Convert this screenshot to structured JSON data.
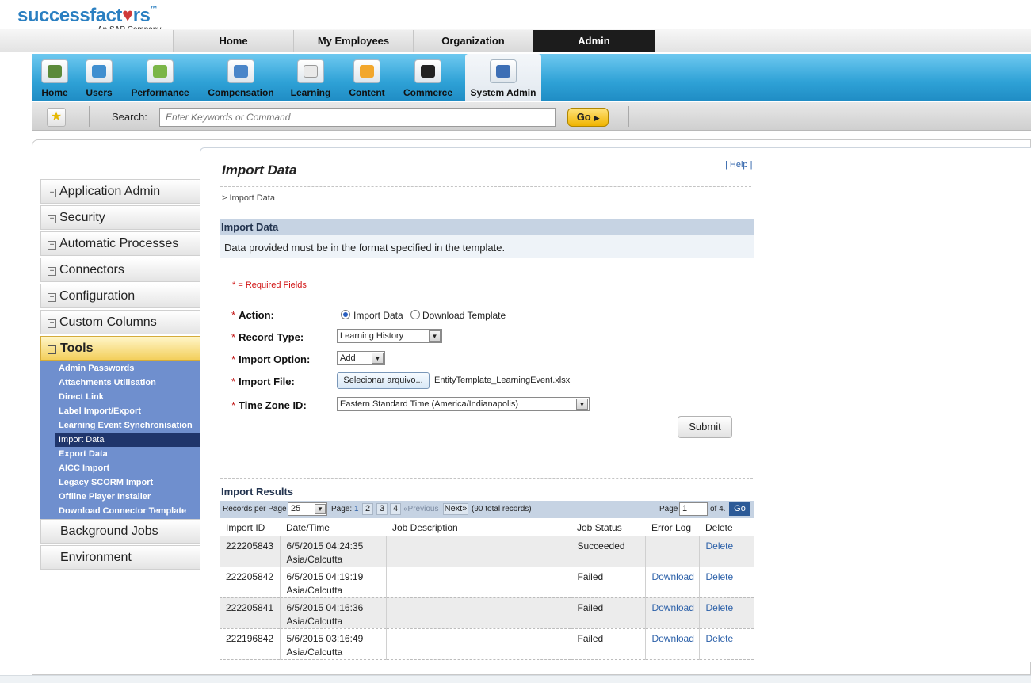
{
  "brand": {
    "logo_text_1": "successfact",
    "logo_heart": "♥",
    "logo_text_2": "rs",
    "tm": "™",
    "subtitle": "An SAP Company"
  },
  "top_tabs": [
    "Home",
    "My Employees",
    "Organization",
    "Admin"
  ],
  "modules": [
    {
      "label": "Home",
      "icon": "home-icon"
    },
    {
      "label": "Users",
      "icon": "users-icon"
    },
    {
      "label": "Performance",
      "icon": "performance-icon"
    },
    {
      "label": "Compensation",
      "icon": "compensation-icon"
    },
    {
      "label": "Learning",
      "icon": "learning-icon"
    },
    {
      "label": "Content",
      "icon": "content-icon"
    },
    {
      "label": "Commerce",
      "icon": "commerce-icon"
    },
    {
      "label": "System Admin",
      "icon": "system-admin-icon"
    }
  ],
  "search": {
    "label": "Search:",
    "placeholder": "Enter Keywords or Command",
    "go": "Go"
  },
  "nav": {
    "items": [
      "Application Admin",
      "Security",
      "Automatic Processes",
      "Connectors",
      "Configuration",
      "Custom Columns"
    ],
    "tools": "Tools",
    "tools_sub": [
      "Admin Passwords",
      "Attachments Utilisation",
      "Direct Link",
      "Label Import/Export",
      "Learning Event Synchronisation",
      "Import Data",
      "Export Data",
      "AICC Import",
      "Legacy SCORM Import",
      "Offline Player Installer",
      "Download Connector Template"
    ],
    "after": [
      "Background Jobs",
      "Environment"
    ]
  },
  "page": {
    "title": "Import Data",
    "help": "Help",
    "breadcrumb": "> Import Data",
    "section_title": "Import Data",
    "section_note": "Data provided must be in the format specified in the template.",
    "required_note": "* = Required Fields",
    "form": {
      "action_label": "Action:",
      "action_opt1": "Import Data",
      "action_opt2": "Download Template",
      "record_type_label": "Record Type:",
      "record_type_value": "Learning History",
      "import_option_label": "Import Option:",
      "import_option_value": "Add",
      "import_file_label": "Import File:",
      "choose_file": "Selecionar arquivo...",
      "file_name": "EntityTemplate_LearningEvent.xlsx",
      "timezone_label": "Time Zone ID:",
      "timezone_value": "Eastern Standard Time (America/Indianapolis)",
      "submit": "Submit"
    }
  },
  "results": {
    "title": "Import Results",
    "records_per_page_label": "Records per Page",
    "records_per_page": "25",
    "page_label": "Page:",
    "pages": [
      "1",
      "2",
      "3",
      "4"
    ],
    "prev": "«Previous",
    "next": "Next»",
    "total": "(90 total records)",
    "page_word": "Page",
    "current_page": "1",
    "of": "of 4.",
    "go": "Go",
    "columns": [
      "Import ID",
      "Date/Time",
      "Job Description",
      "Job Status",
      "Error Log",
      "Delete"
    ],
    "rows": [
      {
        "id": "222205843",
        "date": "6/5/2015 04:24:35",
        "tz": "Asia/Calcutta",
        "desc": "",
        "status": "Succeeded",
        "error": "",
        "delete": "Delete"
      },
      {
        "id": "222205842",
        "date": "6/5/2015 04:19:19",
        "tz": "Asia/Calcutta",
        "desc": "",
        "status": "Failed",
        "error": "Download",
        "delete": "Delete"
      },
      {
        "id": "222205841",
        "date": "6/5/2015 04:16:36",
        "tz": "Asia/Calcutta",
        "desc": "",
        "status": "Failed",
        "error": "Download",
        "delete": "Delete"
      },
      {
        "id": "222196842",
        "date": "5/6/2015 03:16:49",
        "tz": "Asia/Calcutta",
        "desc": "",
        "status": "Failed",
        "error": "Download",
        "delete": "Delete"
      }
    ]
  },
  "colors": {
    "brand_blue": "#2a7fc1",
    "module_bar": "#2ea1d6",
    "active_nav": "#f3cf5c",
    "submenu": "#6f8fce",
    "link": "#2a5fa8"
  }
}
